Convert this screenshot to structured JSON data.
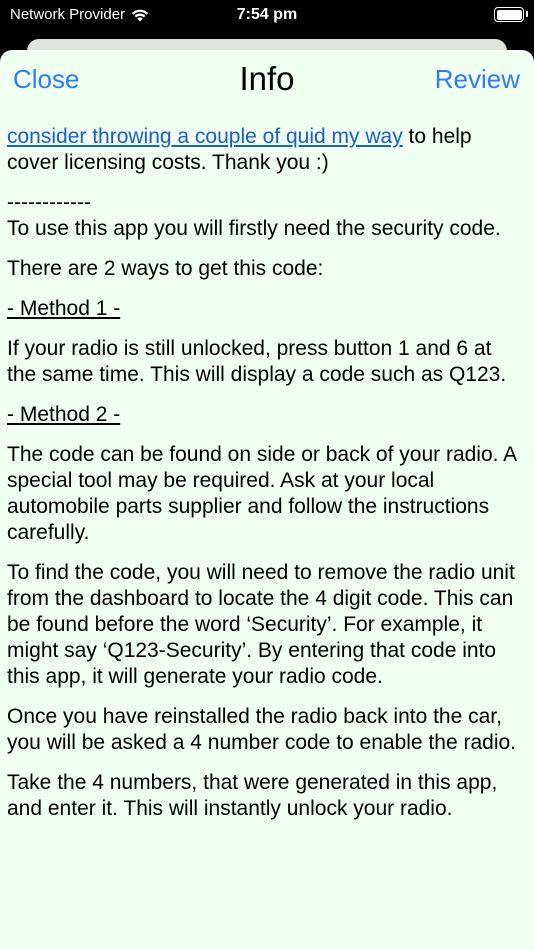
{
  "status": {
    "carrier": "Network Provider",
    "time": "7:54 pm"
  },
  "nav": {
    "close_label": "Close",
    "title": "Info",
    "review_label": "Review"
  },
  "content": {
    "donate_link": "consider throwing a couple of quid my way",
    "donate_tail": " to help cover licensing costs. Thank you :)",
    "separator": "------------",
    "intro": "To use this app you will firstly need the security code.",
    "ways": "There are 2 ways to get this code:",
    "method1_heading": "- Method 1 -",
    "method1_text": "If your radio is still unlocked, press button 1 and 6 at the same time. This will display a code such as Q123.",
    "method2_heading": "- Method 2 -",
    "method2_text": "The code can be found on side or back of your radio. A special tool may be required. Ask at your local automobile parts supplier and follow the instructions carefully.",
    "find_code": "To find the code, you will need to remove the radio unit from the dashboard to locate the 4 digit code. This can be found before the word ‘Security’. For example, it might say ‘Q123-Security’. By entering that code into this app, it will generate your radio code.",
    "reinstall": "Once you have reinstalled the radio back into the car, you will be asked a 4 number code to enable the radio.",
    "final": "Take the 4 numbers, that were generated in this app, and enter it. This will instantly unlock your radio."
  }
}
